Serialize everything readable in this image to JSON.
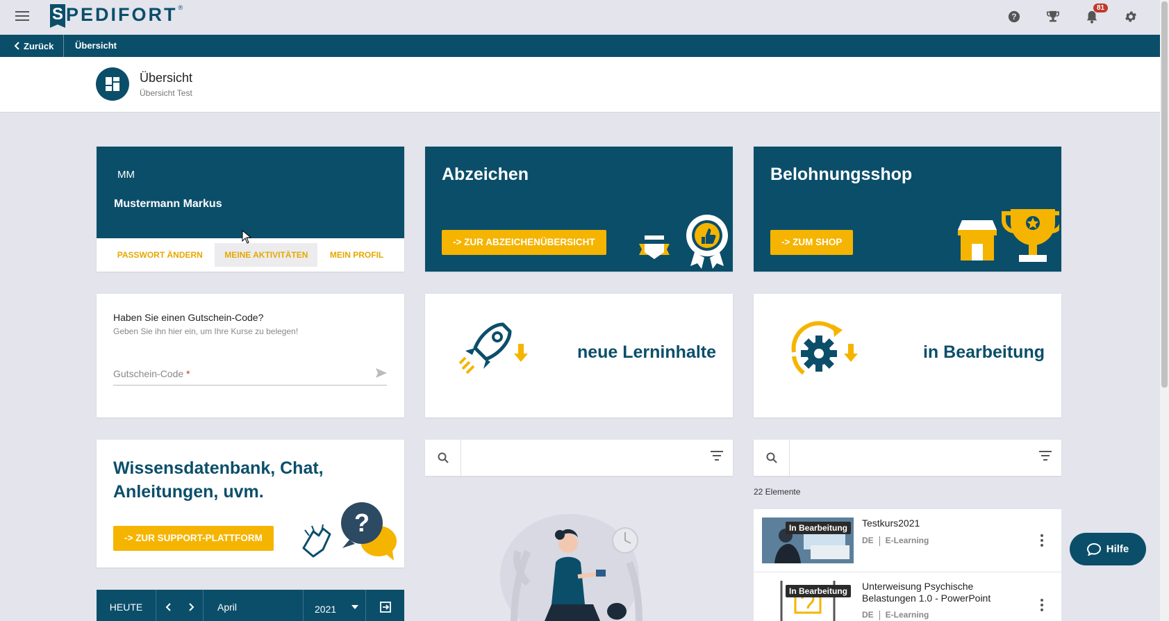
{
  "app": {
    "logo_letter": "S",
    "logo_text": "PEDIFORT",
    "logo_reg": "®",
    "notification_count": "81"
  },
  "nav": {
    "back_label": "Zurück",
    "breadcrumb": "Übersicht"
  },
  "header": {
    "title": "Übersicht",
    "subtitle": "Übersicht Test"
  },
  "profile": {
    "initials": "MM",
    "name": "Mustermann Markus",
    "actions": [
      "PASSWORT ÄNDERN",
      "MEINE AKTIVITÄTEN",
      "MEIN PROFIL"
    ]
  },
  "badges_card": {
    "title": "Abzeichen",
    "button": "-> ZUR ABZEICHENÜBERSICHT"
  },
  "shop_card": {
    "title": "Belohnungsshop",
    "button": "-> ZUM SHOP"
  },
  "voucher": {
    "title": "Haben Sie einen Gutschein-Code?",
    "subtitle": "Geben Sie ihn hier ein, um Ihre Kurse zu belegen!",
    "label": "Gutschein-Code",
    "required_mark": "*"
  },
  "tiles": {
    "new_content": "neue Lerninhalte",
    "in_progress": "in Bearbeitung"
  },
  "support": {
    "title": "Wissensdatenbank, Chat, Anleitungen, uvm.",
    "button": "-> ZUR SUPPORT-PLATTFORM"
  },
  "list": {
    "count": "22 Elemente",
    "items": [
      {
        "badge": "In Bearbeitung",
        "title": "Testkurs2021",
        "lang": "DE",
        "type": "E-Learning"
      },
      {
        "badge": "In Bearbeitung",
        "title": "Unterweisung Psychische Belastungen 1.0 - PowerPoint",
        "lang": "DE",
        "type": "E-Learning"
      }
    ]
  },
  "calendar": {
    "today": "HEUTE",
    "month": "April",
    "year": "2021"
  },
  "help_button": "Hilfe",
  "colors": {
    "primary": "#0b4e6a",
    "accent": "#f5b400",
    "background": "#e3e4ec"
  }
}
